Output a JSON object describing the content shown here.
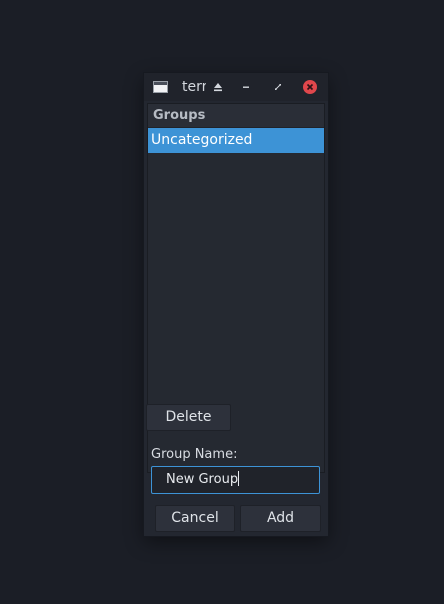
{
  "window": {
    "title": "terr",
    "icon": "terminal-window-icon",
    "controls": [
      "keep-above-icon",
      "minimize-icon",
      "restore-icon",
      "close-icon"
    ]
  },
  "list": {
    "header": "Groups",
    "items": [
      {
        "label": "Uncategorized",
        "selected": true
      }
    ]
  },
  "buttons": {
    "delete": "Delete",
    "cancel": "Cancel",
    "add": "Add"
  },
  "form": {
    "label": "Group Name:",
    "value": "New Group"
  },
  "colors": {
    "accent": "#3d93d6",
    "close": "#e0474c"
  }
}
